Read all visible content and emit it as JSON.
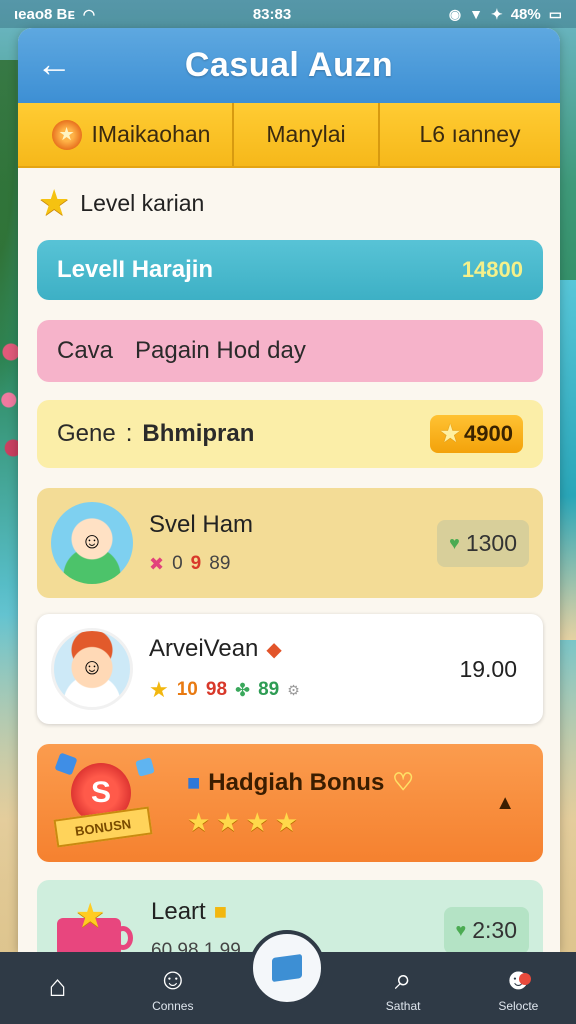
{
  "status_bar": {
    "left_text": "ιeao8 Bᴇ",
    "time": "83:83",
    "battery": "48%"
  },
  "header": {
    "title": "Casual Auzn"
  },
  "tabs": [
    {
      "label": "IMaikaohan"
    },
    {
      "label": "Manylai"
    },
    {
      "label": "L6 ıanney"
    }
  ],
  "level": {
    "label": "Level karian"
  },
  "rows": {
    "blue": {
      "label": "LevelI Harajin",
      "value": "14800"
    },
    "pink": {
      "label_left": "Cava",
      "label_right": "Pagain Hod day"
    },
    "yellow": {
      "label_left": "Gene",
      "label_sep": ":",
      "label_right": "Bhmipran",
      "value": "4900"
    }
  },
  "cards": [
    {
      "title": "Svel Ham",
      "sub_a": "0",
      "sub_b": "9",
      "sub_c": "89",
      "value": "1300"
    },
    {
      "title": "ArveiVean",
      "sub_a": "10",
      "sub_b": "98",
      "sub_c": "89",
      "value": "19.00"
    },
    {
      "title": "Hadgiah Bonus",
      "badge_letter": "S",
      "badge_text": "BONUSN"
    },
    {
      "title": "Leart",
      "sub": "60 98 1.99",
      "value": "2:30"
    }
  ],
  "nav": [
    {
      "label": "",
      "icon": "home-icon"
    },
    {
      "label": "Connes",
      "icon": "person-icon"
    },
    {
      "label": "",
      "icon": "message-icon"
    },
    {
      "label": "Sathat",
      "icon": "search-icon"
    },
    {
      "label": "Selocte",
      "icon": "profile-icon"
    }
  ]
}
